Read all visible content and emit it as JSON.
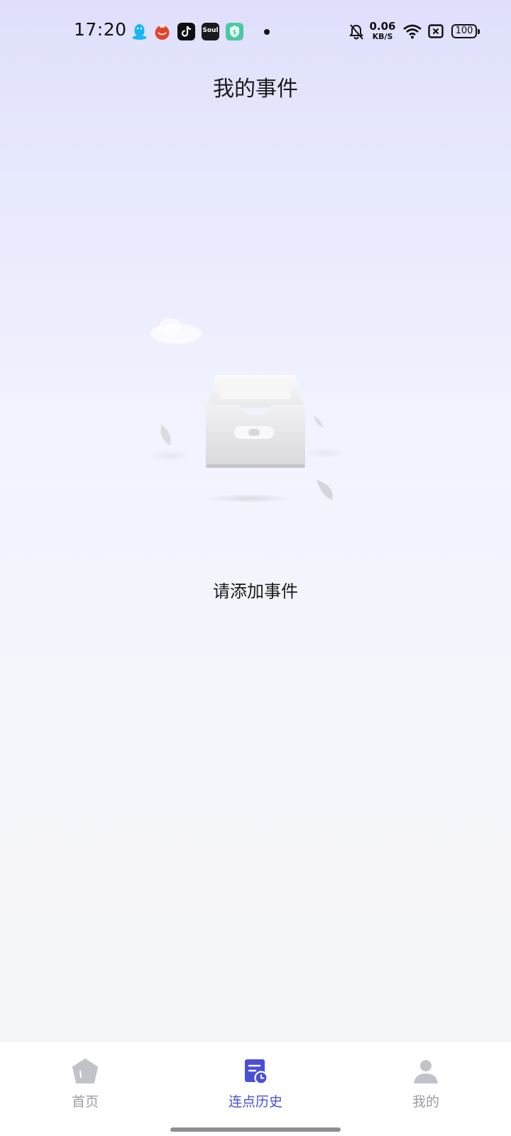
{
  "status_bar": {
    "time": "17:20",
    "notification_icons": [
      "qq-icon",
      "tomato-app-icon",
      "tiktok-icon",
      "soul-app-icon",
      "wallet-app-icon"
    ],
    "soul_label": "Soul",
    "more_indicator": "dot-icon",
    "network_speed": {
      "value": "0.06",
      "unit": "KB/S"
    },
    "battery": "100",
    "system_icons": [
      "bell-muted-icon",
      "wifi-icon",
      "sim-off-icon",
      "battery-icon"
    ]
  },
  "header": {
    "title": "我的事件"
  },
  "empty_state": {
    "illustration": "empty-box-icon",
    "message": "请添加事件"
  },
  "bottom_nav": {
    "items": [
      {
        "label": "首页",
        "icon": "home-icon",
        "active": false
      },
      {
        "label": "连点历史",
        "icon": "history-document-icon",
        "active": true
      },
      {
        "label": "我的",
        "icon": "user-icon",
        "active": false
      }
    ]
  },
  "colors": {
    "accent": "#4b4fd6",
    "inactive": "#9a9ba0",
    "background_top": "#dfdffc",
    "background_bottom": "#f6f7fa"
  }
}
